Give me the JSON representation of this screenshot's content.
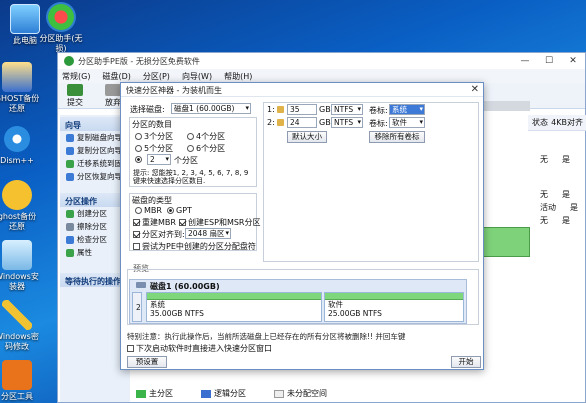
{
  "desktop": {
    "icons": [
      "此电脑",
      "分区助手(无损)",
      "GHOST备份还原",
      "Dism++",
      "ghost备份还原",
      "Windows安装器",
      "Windows密码修改",
      "分区工具"
    ]
  },
  "app": {
    "title": "分区助手PE版 - 无损分区免费软件",
    "menu": [
      "常规(G)",
      "磁盘(D)",
      "分区(P)",
      "向导(W)",
      "帮助(H)"
    ],
    "toolbar": [
      "提交",
      "放弃"
    ],
    "sidebar": {
      "wizard_title": "向导",
      "wizard_items": [
        "复制磁盘向导",
        "复制分区向导",
        "迁移系统到固态",
        "分区恢复向导"
      ],
      "ops_title": "分区操作",
      "ops_items": [
        "创建分区",
        "擦除分区",
        "检查分区",
        "属性"
      ],
      "pending_title": "等待执行的操作"
    },
    "right": {
      "status_header": "状态",
      "cluster_header": "4KB对齐",
      "rows": [
        {
          "status": "无",
          "align": "是"
        },
        {
          "status": "无",
          "align": "是"
        },
        {
          "status": "活动",
          "align": "是"
        },
        {
          "status": "无",
          "align": "是"
        }
      ]
    },
    "legend": [
      "主分区",
      "逻辑分区",
      "未分配空间"
    ],
    "legend_colors": {
      "primary": "#3bb54a",
      "logical": "#3a6fcf",
      "unalloc": "#eeeeee"
    }
  },
  "dialog": {
    "title": "快速分区神器 - 为装机而生",
    "disk_label": "选择磁盘:",
    "disk_value": "磁盘1 (60.00GB)",
    "count_label": "分区的数目",
    "count_options": [
      "3个分区",
      "4个分区",
      "5个分区",
      "6个分区"
    ],
    "count_custom": "2",
    "count_suffix": "个分区",
    "hint": "提示: 您能按1, 2, 3, 4, 5, 6, 7, 8, 9键来快速选择分区数目.",
    "type_label": "磁盘的类型",
    "type_mbr": "MBR",
    "type_gpt": "GPT",
    "rebuild_mbr": "重建MBR",
    "create_esp": "创建ESP和MSR分区",
    "align_label": "分区对齐到:",
    "align_value": "2048 扇区",
    "try_pe": "尝试为PE中创建的分区分配盘符",
    "partitions": [
      {
        "index": "1:",
        "size": "35",
        "unit": "GB",
        "fs": "NTFS",
        "label_name": "卷标:",
        "label": "系统"
      },
      {
        "index": "2:",
        "size": "24",
        "unit": "GB",
        "fs": "NTFS",
        "label_name": "卷标:",
        "label": "软件"
      }
    ],
    "default_size_btn": "默认大小",
    "remove_labels_btn": "移除所有卷标",
    "preview_label": "预览",
    "preview_disk": "磁盘1 (60.00GB)",
    "preview_num": "2",
    "preview_parts": [
      {
        "name": "系统",
        "info": "35.00GB NTFS"
      },
      {
        "name": "软件",
        "info": "25.00GB NTFS"
      }
    ],
    "note": "特别注意：执行此操作后，当前所选磁盘上已经存在的所有分区将被删除!! 并回车键",
    "direct_enter": "下次启动软件时直接进入快速分区窗口",
    "preset_btn": "预设置",
    "start_btn": "开始"
  }
}
